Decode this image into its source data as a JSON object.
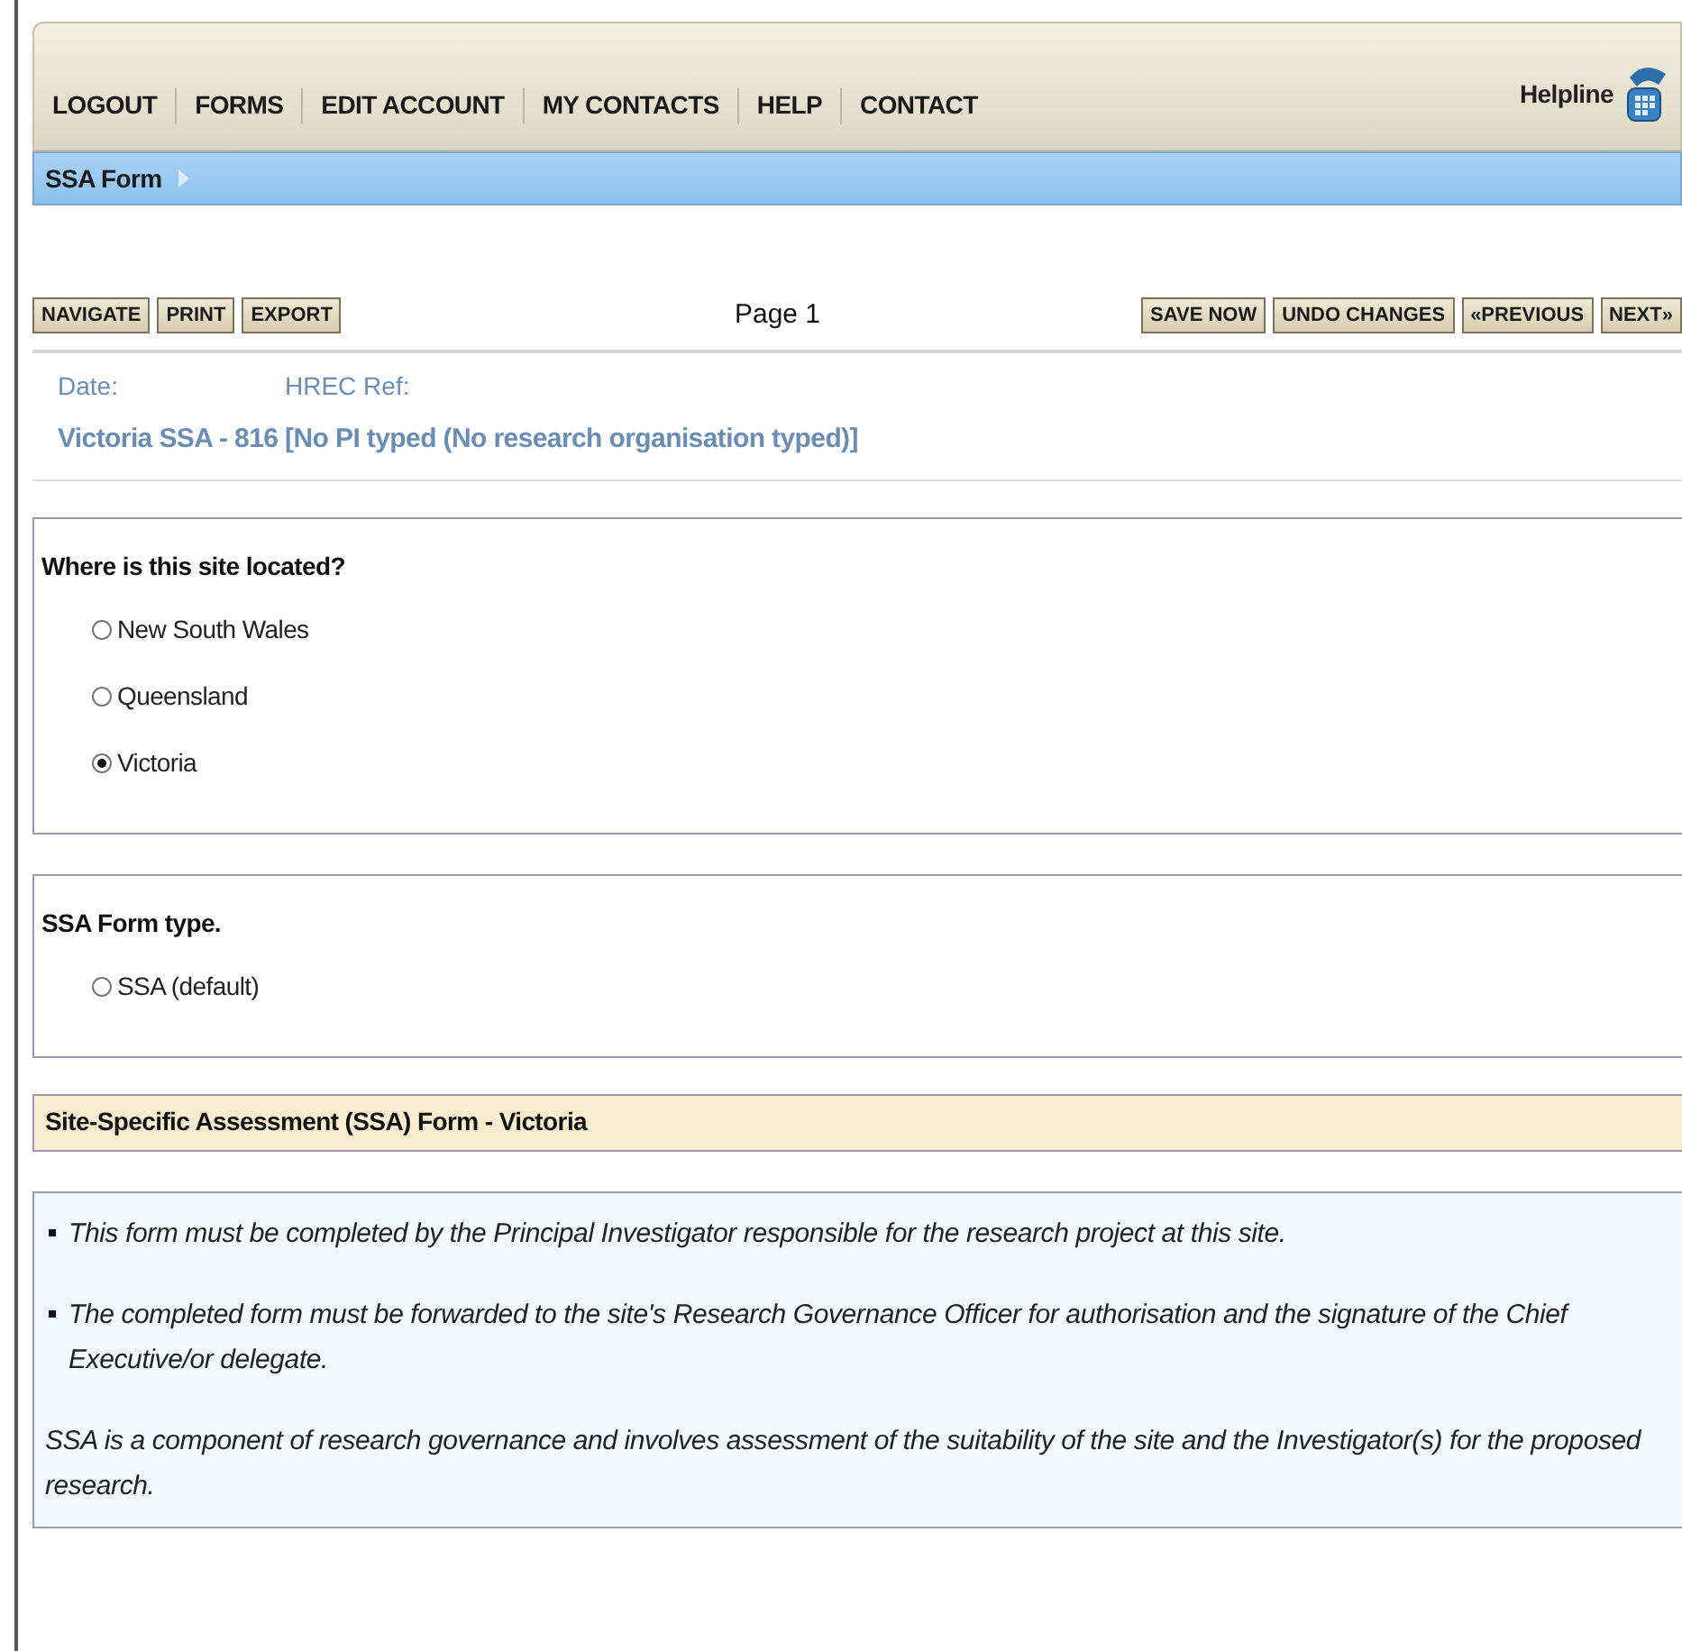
{
  "nav": {
    "items": [
      "LOGOUT",
      "FORMS",
      "EDIT ACCOUNT",
      "MY CONTACTS",
      "HELP",
      "CONTACT"
    ],
    "helpline": "Helpline"
  },
  "breadcrumb": "SSA Form",
  "toolbar": {
    "left_buttons": [
      "NAVIGATE",
      "PRINT",
      "EXPORT"
    ],
    "page": "Page 1",
    "right_buttons": [
      "SAVE NOW",
      "UNDO CHANGES",
      "«PREVIOUS",
      "NEXT»"
    ]
  },
  "meta": {
    "date_label": "Date:",
    "hrec_label": "HREC Ref:",
    "title": "Victoria SSA - 816 [No PI typed (No research organisation typed)]"
  },
  "questions": [
    {
      "label": "Where is this site located?",
      "options": [
        {
          "label": "New South Wales",
          "selected": false
        },
        {
          "label": "Queensland",
          "selected": false
        },
        {
          "label": "Victoria",
          "selected": true
        }
      ]
    },
    {
      "label": "SSA Form type.",
      "options": [
        {
          "label": "SSA (default)",
          "selected": false
        }
      ]
    }
  ],
  "section": {
    "title": "Site-Specific Assessment (SSA) Form - Victoria",
    "paragraphs": [
      {
        "text": "This form must be completed by the Principal Investigator responsible for the research project at this site.",
        "bullet": true
      },
      {
        "text": "The completed form must be forwarded to the site's Research Governance Officer for authorisation and the signature of the Chief Executive/or delegate.",
        "bullet": true
      },
      {
        "text": "SSA is a component of research governance and involves assessment of the suitability of the site and the Investigator(s) for the proposed research.",
        "bullet": false
      }
    ]
  }
}
